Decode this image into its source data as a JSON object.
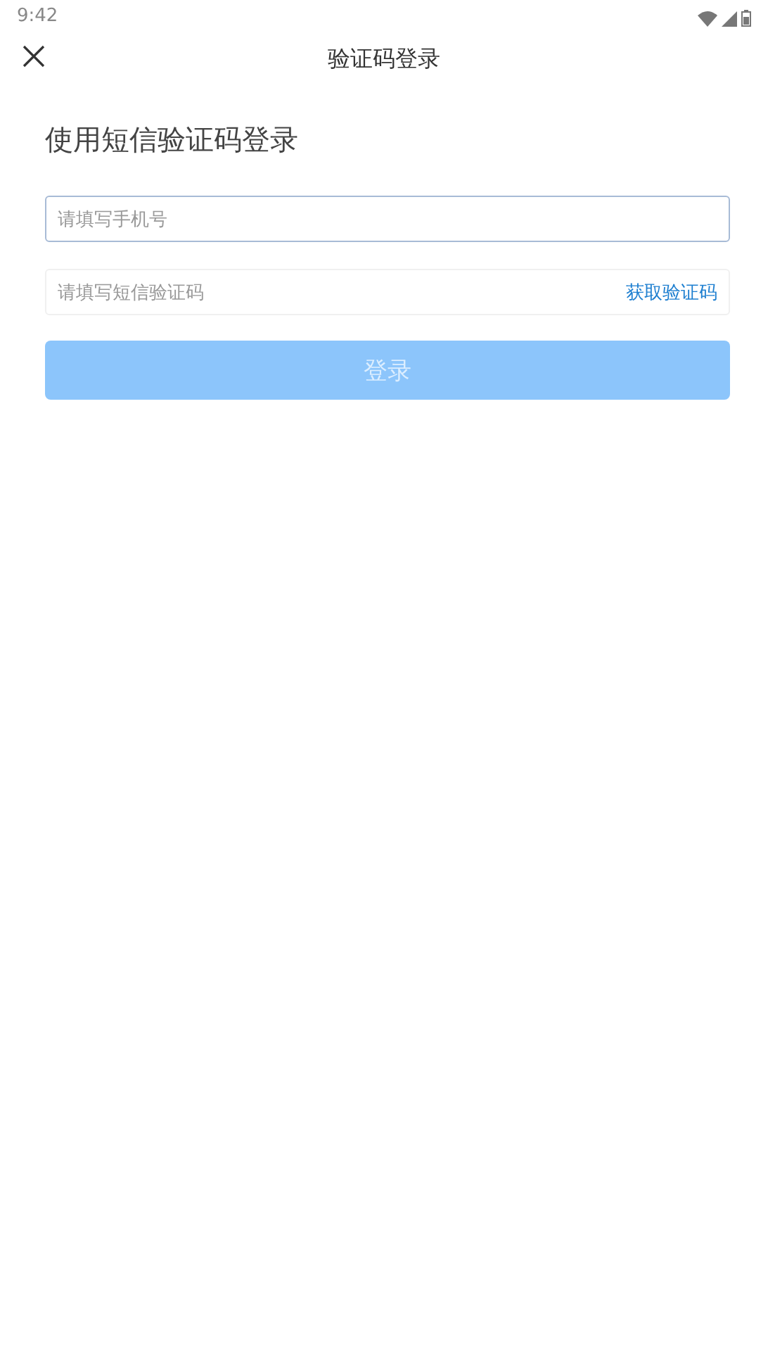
{
  "status_bar": {
    "time": "9:42"
  },
  "header": {
    "title": "验证码登录"
  },
  "heading": "使用短信验证码登录",
  "phone_field": {
    "placeholder": "请填写手机号",
    "focused": true
  },
  "code_field": {
    "placeholder": "请填写短信验证码",
    "focused": false,
    "action": "获取验证码"
  },
  "login_button": {
    "label": "登录",
    "disabled": true
  }
}
